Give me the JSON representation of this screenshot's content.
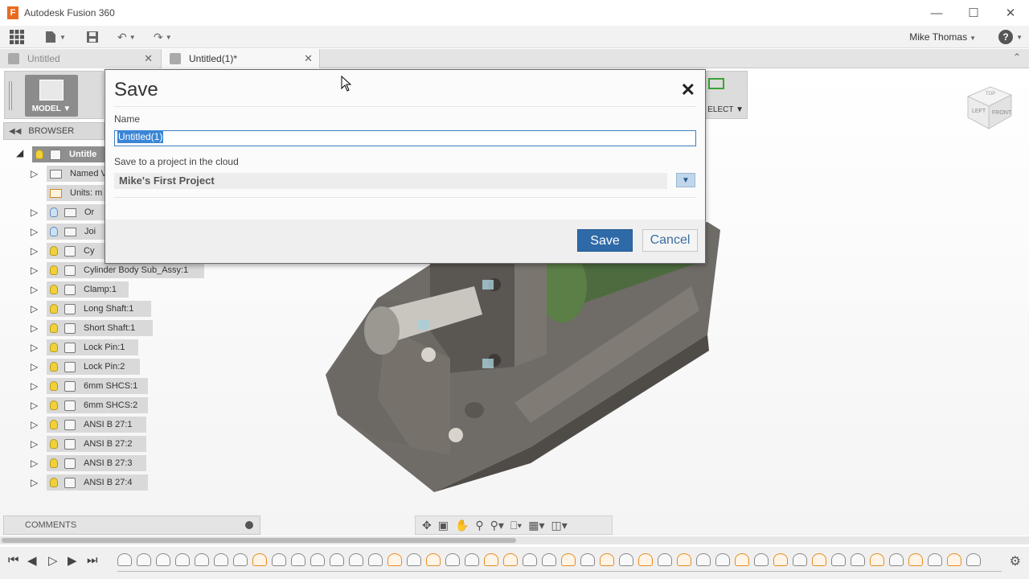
{
  "window": {
    "title": "Autodesk Fusion 360",
    "logo_letter": "F"
  },
  "quick_access": {
    "user": "Mike Thomas"
  },
  "tabs": [
    {
      "label": "Untitled",
      "active": false
    },
    {
      "label": "Untitled(1)*",
      "active": true
    }
  ],
  "toolbar": {
    "workspace_label": "MODEL",
    "select_label": "ELECT"
  },
  "browser": {
    "title": "BROWSER",
    "root": "Untitle",
    "items": [
      {
        "label": "Named V",
        "icon": "folder-icon",
        "light": "none"
      },
      {
        "label": "Units: m",
        "icon": "units-icon",
        "light": "none"
      },
      {
        "label": "Or",
        "icon": "folder-icon",
        "light": "off"
      },
      {
        "label": "Joi",
        "icon": "folder-icon",
        "light": "off"
      },
      {
        "label": "Cy",
        "icon": "component-icon",
        "light": "on"
      },
      {
        "label": "Cylinder Body Sub_Assy:1",
        "icon": "component-icon",
        "light": "on"
      },
      {
        "label": "Clamp:1",
        "icon": "component-icon",
        "light": "on"
      },
      {
        "label": "Long Shaft:1",
        "icon": "component-icon",
        "light": "on"
      },
      {
        "label": "Short Shaft:1",
        "icon": "component-icon",
        "light": "on"
      },
      {
        "label": "Lock Pin:1",
        "icon": "component-icon",
        "light": "on"
      },
      {
        "label": "Lock Pin:2",
        "icon": "component-icon",
        "light": "on"
      },
      {
        "label": "6mm SHCS:1",
        "icon": "component-icon",
        "light": "on"
      },
      {
        "label": "6mm SHCS:2",
        "icon": "component-icon",
        "light": "on"
      },
      {
        "label": "ANSI B 27:1",
        "icon": "component-icon",
        "light": "on"
      },
      {
        "label": "ANSI B 27:2",
        "icon": "component-icon",
        "light": "on"
      },
      {
        "label": "ANSI B 27:3",
        "icon": "component-icon",
        "light": "on"
      },
      {
        "label": "ANSI B 27:4",
        "icon": "component-icon",
        "light": "on"
      }
    ]
  },
  "comments": {
    "label": "COMMENTS"
  },
  "viewcube": {
    "top": "TOP",
    "left": "LEFT",
    "front": "FRONT"
  },
  "dialog": {
    "title": "Save",
    "name_label": "Name",
    "name_value": "Untitled(1)",
    "project_label": "Save to a project in the cloud",
    "project_value": "Mike's First Project",
    "save_label": "Save",
    "cancel_label": "Cancel"
  },
  "colors": {
    "accent": "#2f6aa8",
    "selection": "#3a85d6",
    "bulb": "#f0d13a"
  }
}
